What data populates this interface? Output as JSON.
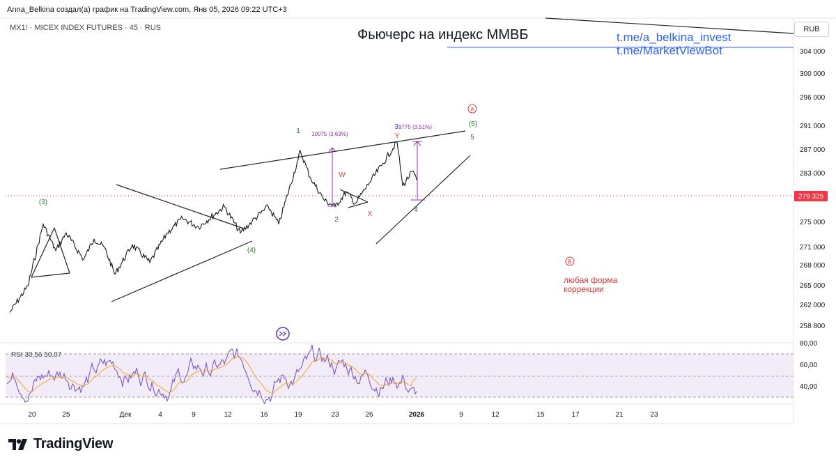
{
  "header": {
    "credit": "Anna_Belkina создал(а) график на TradingView.com, Янв 05, 2026 09:22 UTC+3",
    "symbol": "MX1! · MICEX INDEX FUTURES · 45 · RUS",
    "currency_button": "RUB"
  },
  "brand": {
    "logo_text": "TradingView",
    "logo_icon": "tradingview-logo-icon"
  },
  "colors": {
    "price_line": "#131722",
    "rsi_line": "#7e57c2",
    "rsi_ma": "#f5a623",
    "rsi_band": "#ede7f6",
    "wave_green": "#2e7d32",
    "wave_blue": "#1e5bb8",
    "wave_red": "#e53935",
    "measure": "#9c27b0",
    "link_blue": "#2962ff",
    "last_price_bg": "#f23645"
  },
  "chart_data": {
    "type": "line",
    "title": "Фьючерс на индекс ММВБ",
    "x_tick_labels": [
      "20",
      "25",
      "Дек",
      "4",
      "9",
      "12",
      "16",
      "19",
      "23",
      "26",
      "2026",
      "9",
      "12",
      "15",
      "17",
      "21",
      "23"
    ],
    "y_tick_labels": [
      "304 000",
      "300 000",
      "296 000",
      "291 000",
      "287 000",
      "283 000",
      "275 000",
      "271 000",
      "268 000",
      "265 000",
      "262 000",
      "258 800"
    ],
    "last_price": "279 325",
    "series": [
      {
        "name": "MX1!",
        "approx_path": [
          [
            "start",
            259500
          ],
          [
            "20",
            264000
          ],
          [
            "21",
            274500
          ],
          [
            "23",
            270000
          ],
          [
            "25",
            273000
          ],
          [
            "27",
            268500
          ],
          [
            "28",
            272000
          ],
          [
            "Дек 1",
            270500
          ],
          [
            "2",
            266000
          ],
          [
            "3",
            271000
          ],
          [
            "4",
            268000
          ],
          [
            "6",
            273000
          ],
          [
            "9",
            275500
          ],
          [
            "11",
            274000
          ],
          [
            "12",
            277500
          ],
          [
            "14",
            273000
          ],
          [
            "15",
            275000
          ],
          [
            "17",
            277500
          ],
          [
            "18",
            274500
          ],
          [
            "19a",
            285500
          ],
          [
            "19b",
            287000
          ],
          [
            "20",
            282500
          ],
          [
            "22",
            278500
          ],
          [
            "23",
            277500
          ],
          [
            "24",
            280000
          ],
          [
            "25",
            278000
          ],
          [
            "26",
            281500
          ],
          [
            "27",
            284500
          ],
          [
            "29",
            288500
          ],
          [
            "30",
            281000
          ],
          [
            "31",
            283500
          ],
          [
            "2026",
            282000
          ]
        ]
      }
    ],
    "rsi": {
      "label": "RSI 30,56 50,07",
      "value": 30.56,
      "ma_value": 50.07,
      "y_tick_labels": [
        "80,00",
        "60,00",
        "40,00"
      ]
    },
    "annotations": {
      "wave_labels": [
        "(3)",
        "(4)",
        "(5)",
        "1",
        "2",
        "3",
        "4",
        "5",
        "W",
        "X",
        "Y"
      ],
      "circled_a": "A",
      "circled_b": "B",
      "measure_1": "10075 (3,63%)",
      "measure_2": "9775 (3,51%)",
      "note": [
        "любая форма",
        "коррекции"
      ],
      "links": [
        "t.me/a_belkina_invest",
        "t.me/MarketViewBot"
      ]
    },
    "grid": false
  }
}
